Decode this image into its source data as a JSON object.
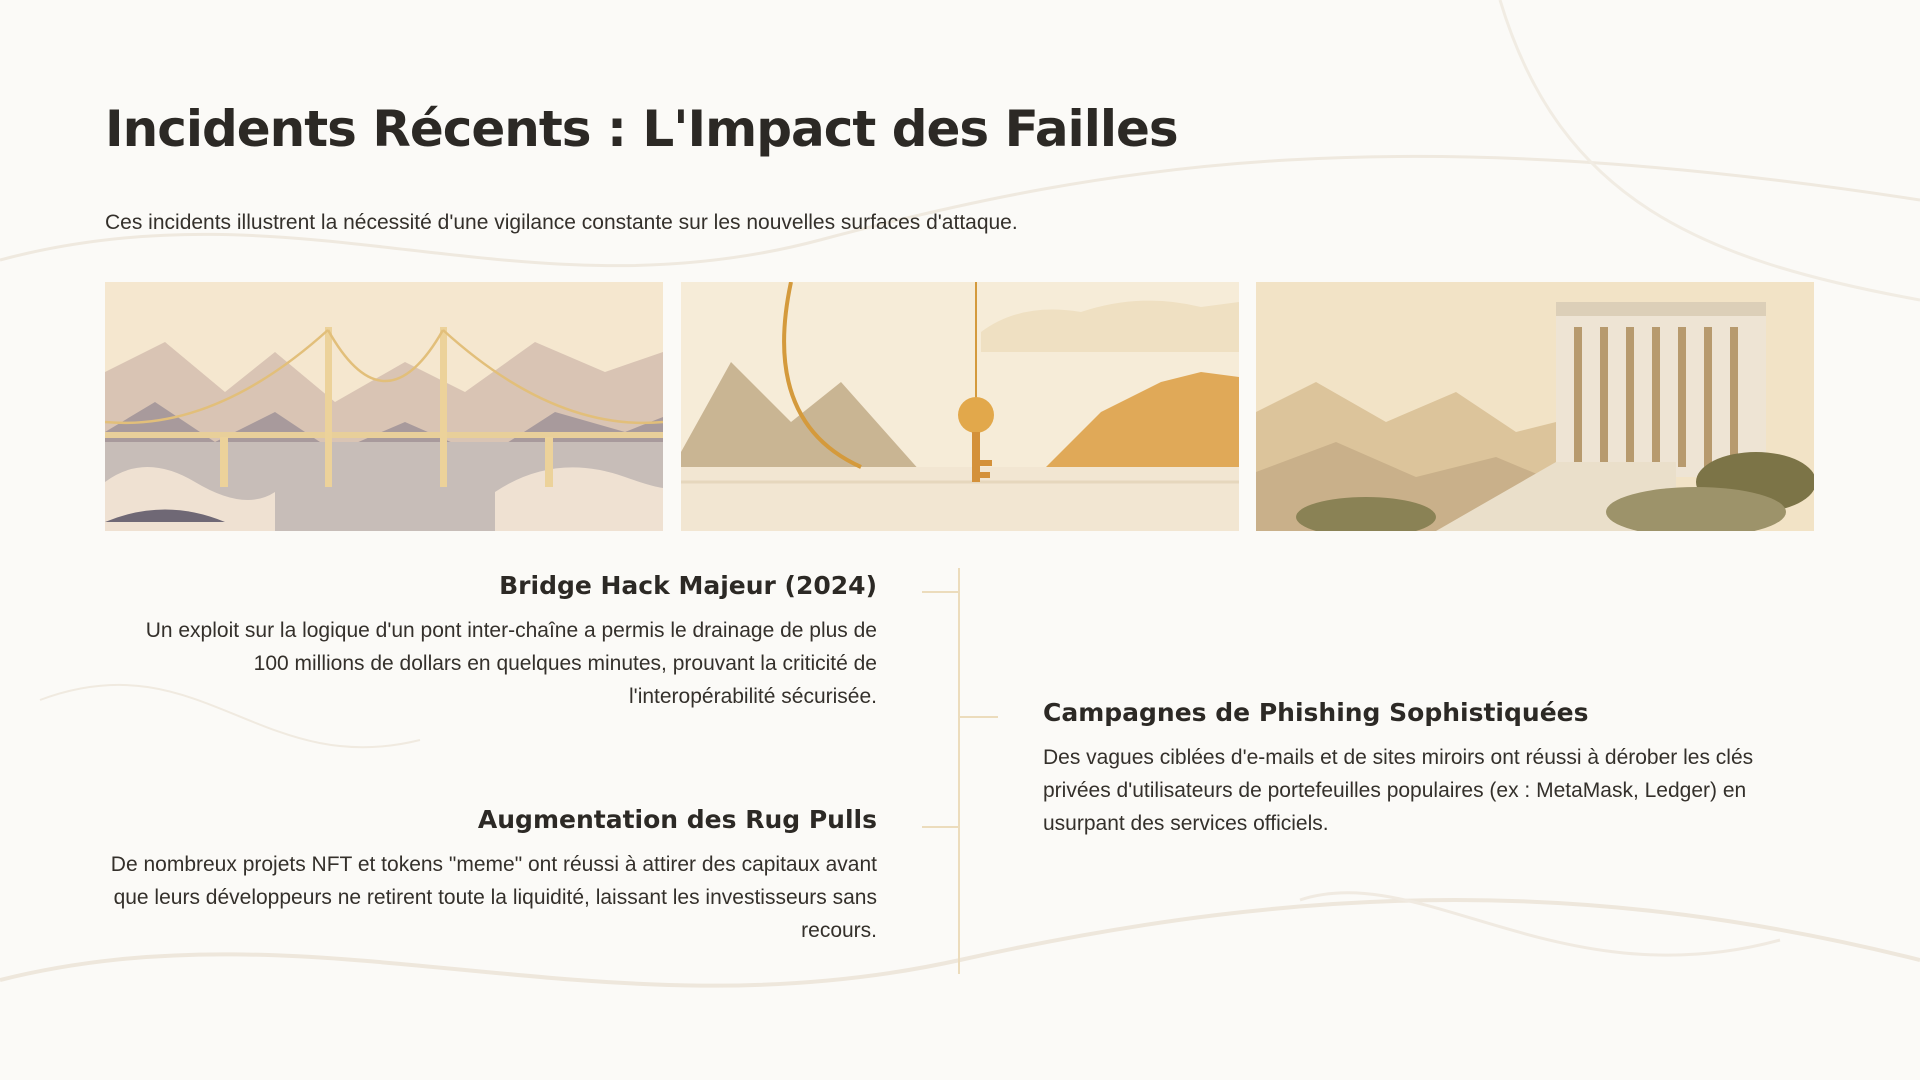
{
  "slide": {
    "title": "Incidents Récents : L'Impact des Failles",
    "subtitle": "Ces incidents illustrent la nécessité d'une vigilance constante sur les nouvelles surfaces d'attaque."
  },
  "images": [
    {
      "subject": "suspension-bridge-illustration"
    },
    {
      "subject": "hook-and-key-illustration"
    },
    {
      "subject": "bank-building-illustration"
    }
  ],
  "events": [
    {
      "title": "Bridge Hack Majeur (2024)",
      "text": "Un exploit sur la logique d'un pont inter-chaîne a permis le drainage de plus de 100 millions de dollars en quelques minutes, prouvant la criticité de l'interopérabilité sécurisée."
    },
    {
      "title": "Augmentation des Rug Pulls",
      "text": "De nombreux projets NFT et tokens \"meme\" ont réussi à attirer des capitaux avant que leurs développeurs ne retirent toute la liquidité, laissant les investisseurs sans recours."
    },
    {
      "title": "Campagnes de Phishing Sophistiquées",
      "text": "Des vagues ciblées d'e-mails et de sites miroirs ont réussi à dérober les clés privées d'utilisateurs de portefeuilles populaires (ex : MetaMask, Ledger) en usurpant des services officiels."
    }
  ],
  "colors": {
    "background": "#fbfaf7",
    "heading": "#2c2925",
    "body_text": "#34302b",
    "timeline_accent": "#ecdcbc",
    "gold": "#d9a441"
  }
}
